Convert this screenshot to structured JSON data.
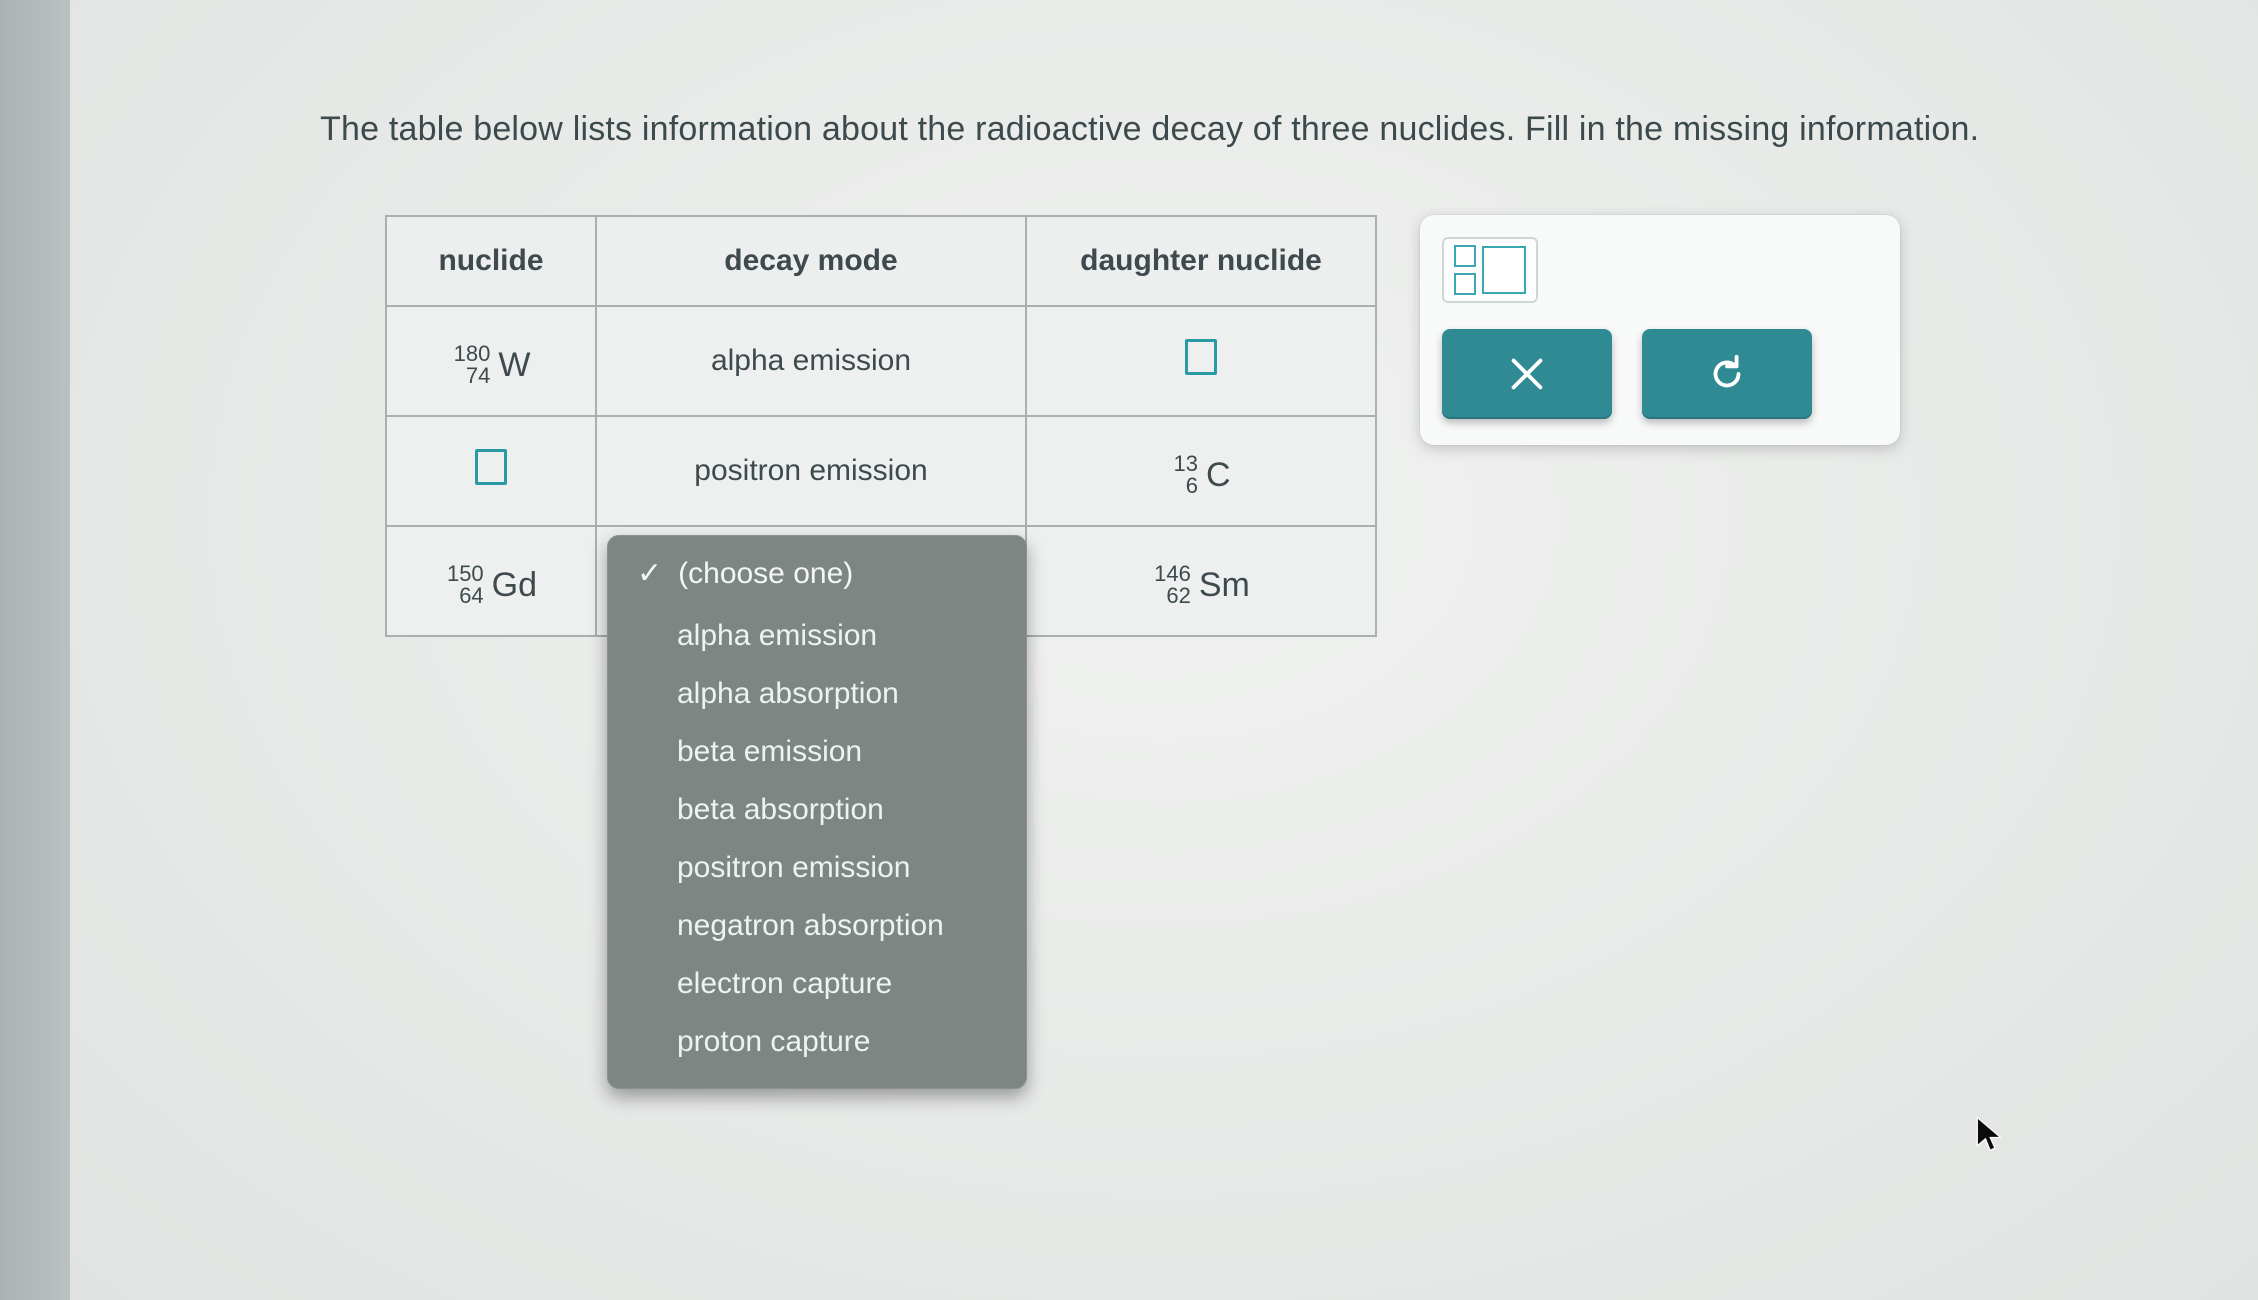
{
  "prompt": "The table below lists information about the radioactive decay of three nuclides. Fill in the missing information.",
  "headers": {
    "nuclide": "nuclide",
    "decay": "decay mode",
    "daughter": "daughter nuclide"
  },
  "rows": [
    {
      "nuclide": {
        "mass": "180",
        "atomic": "74",
        "symbol": "W"
      },
      "decay_text": "alpha emission",
      "daughter_blank": true
    },
    {
      "nuclide_blank": true,
      "decay_text": "positron emission",
      "daughter": {
        "mass": "13",
        "atomic": "6",
        "symbol": "C"
      }
    },
    {
      "nuclide": {
        "mass": "150",
        "atomic": "64",
        "symbol": "Gd"
      },
      "daughter": {
        "mass": "146",
        "atomic": "62",
        "symbol": "Sm"
      }
    }
  ],
  "dropdown": {
    "selected": "(choose one)",
    "options": [
      "alpha emission",
      "alpha absorption",
      "beta emission",
      "beta absorption",
      "positron emission",
      "negatron absorption",
      "electron capture",
      "proton capture"
    ]
  },
  "toolbox": {
    "close": "×",
    "reset": "↺"
  }
}
